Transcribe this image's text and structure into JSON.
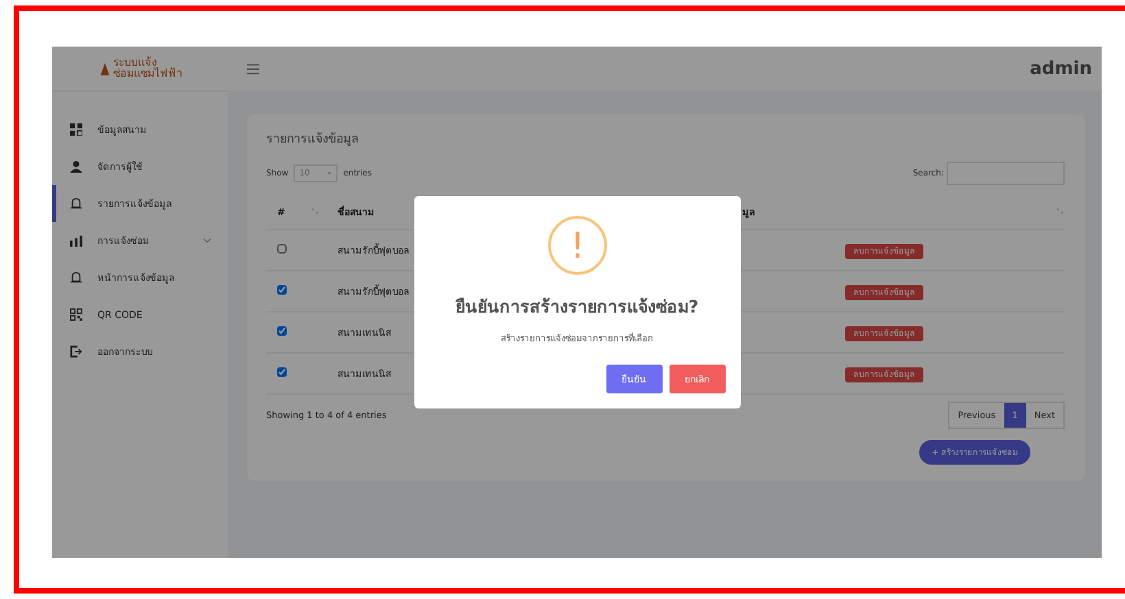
{
  "logo": {
    "line_1": "ระบบแจ้ง",
    "line_2": "ซ่อมแซมไฟฟ้า"
  },
  "topbar": {
    "user": "admin"
  },
  "sidebar": {
    "items": [
      {
        "label": "ข้อมูลสนาม",
        "selected": false,
        "has_submenu": false
      },
      {
        "label": "จัดการผู้ใช้",
        "selected": false,
        "has_submenu": false
      },
      {
        "label": "รายการแจ้งข้อมูล",
        "selected": true,
        "has_submenu": false
      },
      {
        "label": "การแจ้งซ่อม",
        "selected": false,
        "has_submenu": true
      },
      {
        "label": "หน้าการแจ้งข้อมูล",
        "selected": false,
        "has_submenu": false
      },
      {
        "label": "QR CODE",
        "selected": false,
        "has_submenu": false
      },
      {
        "label": "ออกจากระบบ",
        "selected": false,
        "has_submenu": false
      }
    ]
  },
  "card": {
    "title": "รายการแจ้งข้อมูล",
    "length": {
      "before": "Show",
      "value": "10",
      "after": "entries"
    },
    "search_label": "Search:",
    "table": {
      "columns": [
        "#",
        "ชื่อสนาม",
        "มูล"
      ],
      "rows": [
        {
          "checked": false,
          "name": "สนามรักบี้ฟุตบอล",
          "action": "ลบการแจ้งข้อมูล"
        },
        {
          "checked": true,
          "name": "สนามรักบี้ฟุตบอล",
          "action": "ลบการแจ้งข้อมูล"
        },
        {
          "checked": true,
          "name": "สนามเทนนิส",
          "action": "ลบการแจ้งข้อมูล"
        },
        {
          "checked": true,
          "name": "สนามเทนนิส",
          "action": "ลบการแจ้งข้อมูล"
        }
      ]
    },
    "info": "Showing 1 to 4 of 4 entries",
    "pagination": [
      {
        "label": "Previous",
        "selected": false
      },
      {
        "label": "1",
        "selected": true
      },
      {
        "label": "Next",
        "selected": false
      }
    ],
    "create_button": {
      "icon": "+",
      "label": "สร้างรายการแจ้งซ่อม"
    }
  },
  "dialog": {
    "icon": "!",
    "title": "ยืนยันการสร้างรายการแจ้งซ่อม?",
    "text": "สร้างรายการแจ้งซ่อมจากรายการที่เลือก",
    "buttons": [
      {
        "kind": "confirm",
        "label": "ยืนยัน"
      },
      {
        "kind": "cancel",
        "label": "ยกเลิก"
      }
    ]
  }
}
